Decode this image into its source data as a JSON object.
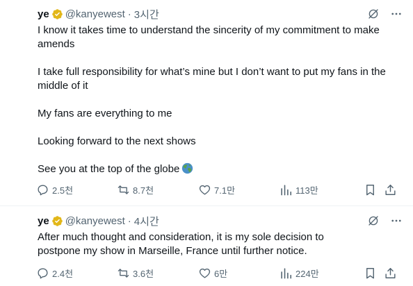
{
  "tweets": [
    {
      "author": {
        "name": "ye",
        "handle": "@kanyewest",
        "dot": "·",
        "time": "3시간"
      },
      "paragraphs": [
        "I know it takes time to understand the sincerity of my commitment to make amends",
        "I take full responsibility for what’s mine but I don’t want to put my fans in the middle of it",
        "My fans are everything to me",
        "Looking forward to the next shows",
        "See you at the top of the globe"
      ],
      "stats": {
        "replies": "2.5천",
        "reposts": "8.7천",
        "likes": "7.1만",
        "views": "113만"
      }
    },
    {
      "author": {
        "name": "ye",
        "handle": "@kanyewest",
        "dot": "·",
        "time": "4시간"
      },
      "paragraphs": [
        "After much thought and consideration, it is my sole decision to postpone my show in Marseille, France until further notice."
      ],
      "stats": {
        "replies": "2.4천",
        "reposts": "3.6천",
        "likes": "6만",
        "views": "224만"
      }
    }
  ],
  "icons": {
    "verified": "verified-badge-icon",
    "grok": "grok-icon",
    "more": "more-icon",
    "reply": "reply-icon",
    "repost": "repost-icon",
    "like": "heart-icon",
    "views": "views-icon",
    "bookmark": "bookmark-icon",
    "share": "share-icon",
    "globe_emoji": "globe-emoji-icon"
  },
  "colors": {
    "verified_gold": "#e2b719",
    "text": "#0f1419",
    "muted": "#536471",
    "divider": "#eff3f4"
  }
}
